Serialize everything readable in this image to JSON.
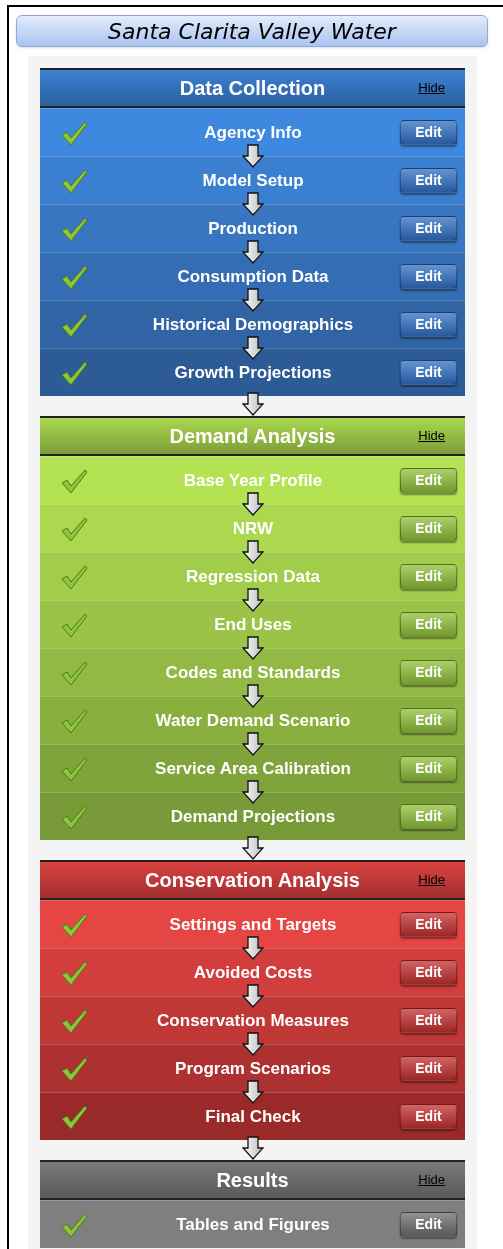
{
  "title": "Santa Clarita Valley Water",
  "sections": [
    {
      "title": "Data Collection",
      "hide_link": "Hide",
      "kind": "blue",
      "steps": [
        {
          "label": "Agency Info",
          "checked": true,
          "button": "Edit"
        },
        {
          "label": "Model Setup",
          "checked": true,
          "button": "Edit"
        },
        {
          "label": "Production",
          "checked": true,
          "button": "Edit"
        },
        {
          "label": "Consumption Data",
          "checked": true,
          "button": "Edit"
        },
        {
          "label": "Historical Demographics",
          "checked": true,
          "button": "Edit"
        },
        {
          "label": "Growth Projections",
          "checked": true,
          "button": "Edit"
        }
      ]
    },
    {
      "title": "Demand Analysis",
      "hide_link": "Hide",
      "kind": "green",
      "steps": [
        {
          "label": "Base Year Profile",
          "checked": true,
          "button": "Edit"
        },
        {
          "label": "NRW",
          "checked": true,
          "button": "Edit"
        },
        {
          "label": "Regression Data",
          "checked": true,
          "button": "Edit"
        },
        {
          "label": "End Uses",
          "checked": true,
          "button": "Edit"
        },
        {
          "label": "Codes and Standards",
          "checked": true,
          "button": "Edit"
        },
        {
          "label": "Water Demand Scenario",
          "checked": true,
          "button": "Edit"
        },
        {
          "label": "Service Area Calibration",
          "checked": true,
          "button": "Edit"
        },
        {
          "label": "Demand Projections",
          "checked": true,
          "button": "Edit"
        }
      ]
    },
    {
      "title": "Conservation Analysis",
      "hide_link": "Hide",
      "kind": "red",
      "steps": [
        {
          "label": "Settings and Targets",
          "checked": true,
          "button": "Edit"
        },
        {
          "label": "Avoided Costs",
          "checked": true,
          "button": "Edit"
        },
        {
          "label": "Conservation Measures",
          "checked": true,
          "button": "Edit"
        },
        {
          "label": "Program Scenarios",
          "checked": true,
          "button": "Edit"
        },
        {
          "label": "Final Check",
          "checked": true,
          "button": "Edit"
        }
      ]
    },
    {
      "title": "Results",
      "hide_link": "Hide",
      "kind": "gray",
      "steps": [
        {
          "label": "Tables and Figures",
          "checked": true,
          "button": "Edit"
        }
      ]
    }
  ]
}
